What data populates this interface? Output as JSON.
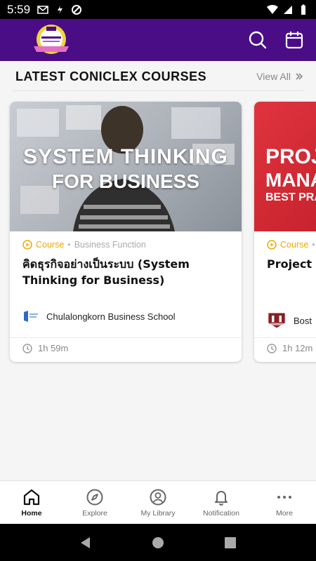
{
  "status_bar": {
    "time": "5:59",
    "left_icons": [
      "gmail-icon",
      "sync-icon",
      "dnd-icon"
    ],
    "right_icons": [
      "wifi-icon",
      "signal-icon",
      "battery-icon"
    ]
  },
  "app_bar": {
    "logo_icon": "leadership-logo-icon",
    "colors": {
      "background": "#4a0d86"
    },
    "actions": [
      "search-icon",
      "calendar-icon"
    ]
  },
  "section": {
    "title": "LATEST CONICLEX COURSES",
    "view_all": "View All"
  },
  "courses": [
    {
      "thumb_line1": "SYSTEM THINKING",
      "thumb_line2": "FOR BUSINESS",
      "type": "Course",
      "category": "Business Function",
      "title": "คิดธุรกิจอย่างเป็นระบบ (System Thinking for Business)",
      "provider": "Chulalongkorn Business School",
      "duration": "1h 59m"
    },
    {
      "thumb_line1": "PROJ",
      "thumb_line2": "MANA",
      "thumb_line3": "BEST PRA",
      "type": "Course",
      "category": "",
      "title": "Project M",
      "provider": "Bost",
      "duration": "1h 12m"
    }
  ],
  "bottom_nav": [
    {
      "label": "Home",
      "icon": "home-icon",
      "active": true
    },
    {
      "label": "Explore",
      "icon": "compass-icon",
      "active": false
    },
    {
      "label": "My Library",
      "icon": "user-circle-icon",
      "active": false
    },
    {
      "label": "Notification",
      "icon": "bell-icon",
      "active": false
    },
    {
      "label": "More",
      "icon": "more-icon",
      "active": false
    }
  ],
  "system_nav": [
    "back-icon",
    "home-button-icon",
    "recents-icon"
  ]
}
